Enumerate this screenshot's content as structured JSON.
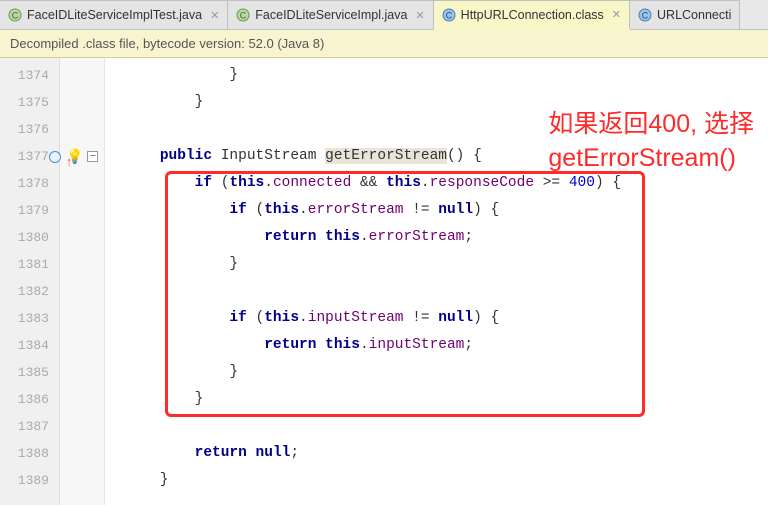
{
  "tabs": [
    {
      "label": "FaceIDLiteServiceImplTest.java",
      "active": false
    },
    {
      "label": "FaceIDLiteServiceImpl.java",
      "active": false
    },
    {
      "label": "HttpURLConnection.class",
      "active": true
    },
    {
      "label": "URLConnecti",
      "active": false
    }
  ],
  "banner": {
    "text": "Decompiled .class file, bytecode version: 52.0 (Java 8)"
  },
  "gutter_start": 1374,
  "code": {
    "l1374": "            }",
    "l1375": "        }",
    "l1376": "",
    "l1377": {
      "pre": "    ",
      "k_public": "public",
      "sp1": " InputStream ",
      "method": "getErrorStream",
      "tail": "() {"
    },
    "l1378": {
      "pre": "        ",
      "k_if": "if",
      "a": " (",
      "k_this1": "this",
      "b": ".",
      "f1": "connected",
      "c": " && ",
      "k_this2": "this",
      "d": ".",
      "f2": "responseCode",
      "e": " >= ",
      "num": "400",
      "g": ") {"
    },
    "l1379": {
      "pre": "            ",
      "k_if": "if",
      "a": " (",
      "k_this": "this",
      "b": ".",
      "f": "errorStream",
      "c": " != ",
      "k_null": "null",
      "d": ") {"
    },
    "l1380": {
      "pre": "                ",
      "k_return": "return",
      "a": " ",
      "k_this": "this",
      "b": ".",
      "f": "errorStream",
      "c": ";"
    },
    "l1381": "            }",
    "l1382": "",
    "l1383": {
      "pre": "            ",
      "k_if": "if",
      "a": " (",
      "k_this": "this",
      "b": ".",
      "f": "inputStream",
      "c": " != ",
      "k_null": "null",
      "d": ") {"
    },
    "l1384": {
      "pre": "                ",
      "k_return": "return",
      "a": " ",
      "k_this": "this",
      "b": ".",
      "f": "inputStream",
      "c": ";"
    },
    "l1385": "            }",
    "l1386": "        }",
    "l1387": "",
    "l1388": {
      "pre": "        ",
      "k_return": "return",
      "a": " ",
      "k_null": "null",
      "b": ";"
    },
    "l1389": "    }"
  },
  "annotation": {
    "line1": "如果返回400, 选择",
    "line2": "getErrorStream()"
  }
}
